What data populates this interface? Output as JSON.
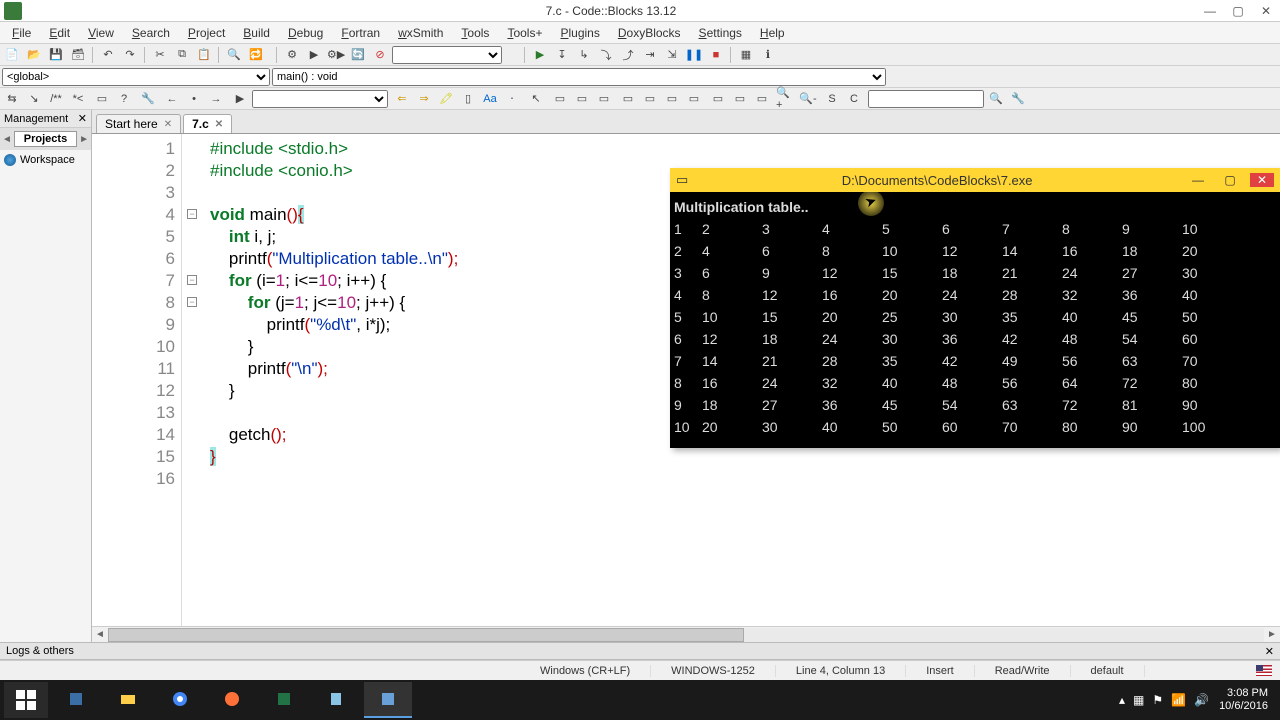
{
  "titlebar": {
    "title": "7.c - Code::Blocks 13.12"
  },
  "menus": [
    "File",
    "Edit",
    "View",
    "Search",
    "Project",
    "Build",
    "Debug",
    "Fortran",
    "wxSmith",
    "Tools",
    "Tools+",
    "Plugins",
    "DoxyBlocks",
    "Settings",
    "Help"
  ],
  "scope": {
    "global": "<global>",
    "func": "main() : void"
  },
  "management": {
    "header": "Management",
    "tab": "Projects",
    "workspace": "Workspace"
  },
  "tabs": {
    "start": "Start here",
    "file": "7.c"
  },
  "code_lines": [
    1,
    2,
    3,
    4,
    5,
    6,
    7,
    8,
    9,
    10,
    11,
    12,
    13,
    14,
    15,
    16
  ],
  "src": {
    "l1a": "#include ",
    "l1b": "<stdio.h>",
    "l2a": "#include ",
    "l2b": "<conio.h>",
    "l4a": "void",
    "l4b": " main",
    "l4c": "()",
    "l4d": "{",
    "l5a": "    ",
    "l5b": "int",
    "l5c": " i, j;",
    "l6a": "    printf",
    "l6b": "(",
    "l6c": "\"Multiplication table..\\n\"",
    "l6d": ");",
    "l7a": "    ",
    "l7b": "for",
    "l7c": " (i=",
    "l7d": "1",
    "l7e": "; i<=",
    "l7f": "10",
    "l7g": "; i++) {",
    "l8a": "        ",
    "l8b": "for",
    "l8c": " (j=",
    "l8d": "1",
    "l8e": "; j<=",
    "l8f": "10",
    "l8g": "; j++) {",
    "l9a": "            printf",
    "l9b": "(",
    "l9c": "\"%d\\t\"",
    "l9d": ", i*j);",
    "l10": "        }",
    "l11a": "        printf",
    "l11b": "(",
    "l11c": "\"\\n\"",
    "l11d": ");",
    "l12": "    }",
    "l14a": "    getch",
    "l14b": "();",
    "l15": "}"
  },
  "console": {
    "path": "D:\\Documents\\CodeBlocks\\7.exe",
    "header": "Multiplication table..",
    "rows": [
      [
        "1",
        "2",
        "3",
        "4",
        "5",
        "6",
        "7",
        "8",
        "9",
        "10"
      ],
      [
        "2",
        "4",
        "6",
        "8",
        "10",
        "12",
        "14",
        "16",
        "18",
        "20"
      ],
      [
        "3",
        "6",
        "9",
        "12",
        "15",
        "18",
        "21",
        "24",
        "27",
        "30"
      ],
      [
        "4",
        "8",
        "12",
        "16",
        "20",
        "24",
        "28",
        "32",
        "36",
        "40"
      ],
      [
        "5",
        "10",
        "15",
        "20",
        "25",
        "30",
        "35",
        "40",
        "45",
        "50"
      ],
      [
        "6",
        "12",
        "18",
        "24",
        "30",
        "36",
        "42",
        "48",
        "54",
        "60"
      ],
      [
        "7",
        "14",
        "21",
        "28",
        "35",
        "42",
        "49",
        "56",
        "63",
        "70"
      ],
      [
        "8",
        "16",
        "24",
        "32",
        "40",
        "48",
        "56",
        "64",
        "72",
        "80"
      ],
      [
        "9",
        "18",
        "27",
        "36",
        "45",
        "54",
        "63",
        "72",
        "81",
        "90"
      ],
      [
        "10",
        "20",
        "30",
        "40",
        "50",
        "60",
        "70",
        "80",
        "90",
        "100"
      ]
    ]
  },
  "logs": {
    "label": "Logs & others"
  },
  "status": {
    "eol": "Windows (CR+LF)",
    "enc": "WINDOWS-1252",
    "pos": "Line 4, Column 13",
    "mode": "Insert",
    "perm": "Read/Write",
    "profile": "default"
  },
  "tray": {
    "time": "3:08 PM",
    "date": "10/6/2016"
  }
}
